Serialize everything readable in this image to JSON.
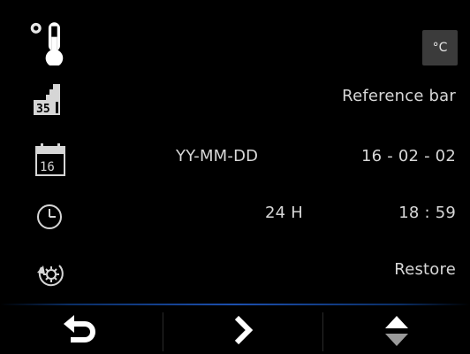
{
  "temperature": {
    "icon": "thermometer-icon",
    "unit_label": "°C"
  },
  "reference_bar": {
    "icon": "reference-bar-icon",
    "icon_text": "35",
    "label": "Reference bar"
  },
  "date": {
    "icon": "calendar-icon",
    "icon_text": "16",
    "format": "YY-MM-DD",
    "value": "16 - 02 - 02"
  },
  "time": {
    "icon": "clock-icon",
    "format": "24 H",
    "value": "18 : 59"
  },
  "restore": {
    "icon": "restore-icon",
    "label": "Restore"
  },
  "bottom_bar": {
    "back": "back-arrow-icon",
    "next": "chevron-right-icon",
    "updown": "up-down-icon"
  },
  "colors": {
    "background": "#000000",
    "text": "#d7d7d7",
    "button_bg": "#3b3b3b",
    "divider": "#1c4fae"
  }
}
